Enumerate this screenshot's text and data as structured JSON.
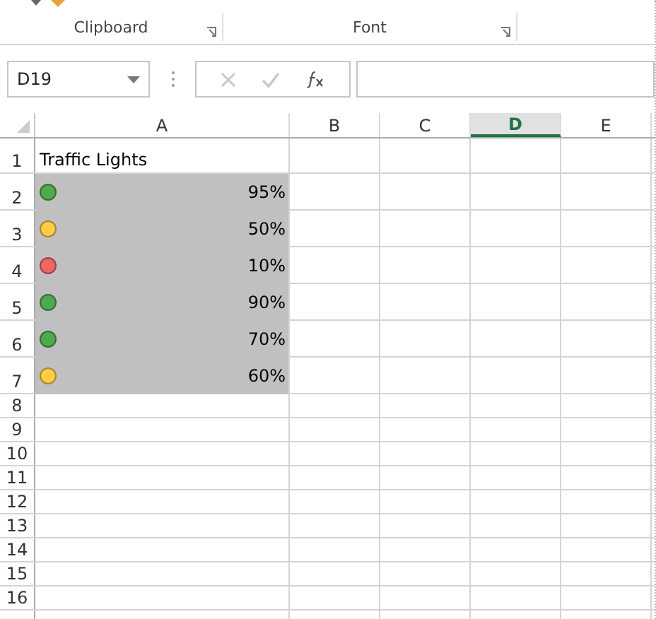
{
  "ribbon": {
    "groups": [
      {
        "label": "Clipboard"
      },
      {
        "label": "Font"
      }
    ]
  },
  "formula_bar": {
    "name_box": "D19"
  },
  "columns": [
    {
      "label": "A",
      "selected": false
    },
    {
      "label": "B",
      "selected": false
    },
    {
      "label": "C",
      "selected": false
    },
    {
      "label": "D",
      "selected": true
    },
    {
      "label": "E",
      "selected": false
    }
  ],
  "rows": [
    {
      "number": "1",
      "kind": "title",
      "text": "Traffic Lights"
    },
    {
      "number": "2",
      "kind": "light",
      "color": "#4fa94f",
      "value": "95%"
    },
    {
      "number": "3",
      "kind": "light",
      "color": "#ffcc44",
      "value": "50%"
    },
    {
      "number": "4",
      "kind": "light",
      "color": "#ee6666",
      "value": "10%"
    },
    {
      "number": "5",
      "kind": "light",
      "color": "#4fa94f",
      "value": "90%"
    },
    {
      "number": "6",
      "kind": "light",
      "color": "#4fa94f",
      "value": "70%"
    },
    {
      "number": "7",
      "kind": "light",
      "color": "#ffcc44",
      "value": "60%"
    },
    {
      "number": "8",
      "kind": "empty"
    },
    {
      "number": "9",
      "kind": "empty"
    },
    {
      "number": "10",
      "kind": "empty"
    },
    {
      "number": "11",
      "kind": "empty"
    },
    {
      "number": "12",
      "kind": "empty"
    },
    {
      "number": "13",
      "kind": "empty"
    },
    {
      "number": "14",
      "kind": "empty"
    },
    {
      "number": "15",
      "kind": "empty"
    },
    {
      "number": "16",
      "kind": "empty"
    },
    {
      "number": "",
      "kind": "empty"
    }
  ]
}
